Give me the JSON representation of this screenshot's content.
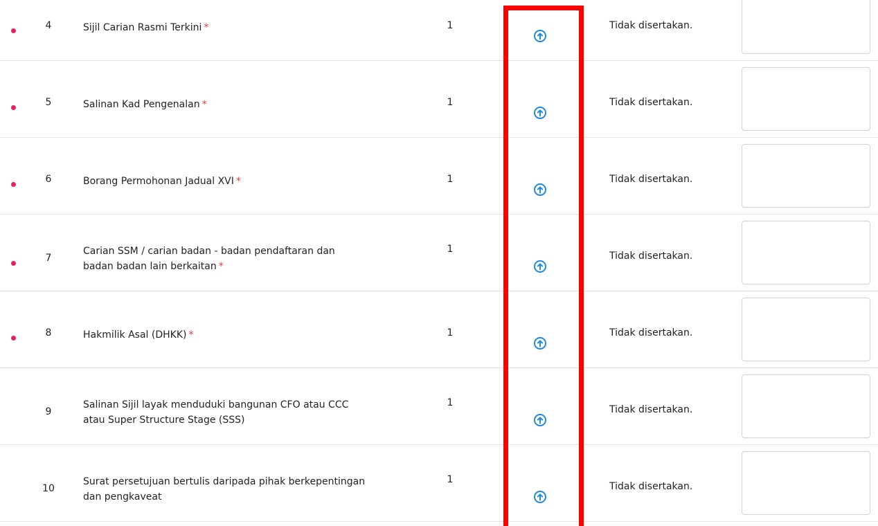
{
  "rows": [
    {
      "num": "4",
      "doc_lines": [
        "Sijil Carian Rasmi Terkini"
      ],
      "required": true,
      "qty": "1",
      "status": "Tidak disertakan."
    },
    {
      "num": "5",
      "doc_lines": [
        "Salinan Kad Pengenalan"
      ],
      "required": true,
      "qty": "1",
      "status": "Tidak disertakan."
    },
    {
      "num": "6",
      "doc_lines": [
        "Borang Permohonan Jadual XVI"
      ],
      "required": true,
      "qty": "1",
      "status": "Tidak disertakan."
    },
    {
      "num": "7",
      "doc_lines": [
        "Carian  SSM / carian badan - badan pendaftaran dan",
        "badan badan lain berkaitan"
      ],
      "required": true,
      "qty": "1",
      "status": "Tidak disertakan."
    },
    {
      "num": "8",
      "doc_lines": [
        "Hakmilik Asal (DHKK)"
      ],
      "required": true,
      "qty": "1",
      "status": "Tidak disertakan."
    },
    {
      "num": "9",
      "doc_lines": [
        "Salinan Sijil layak menduduki bangunan CFO atau CCC",
        "atau Super Structure Stage (SSS)"
      ],
      "required": false,
      "qty": "1",
      "status": "Tidak disertakan."
    },
    {
      "num": "10",
      "doc_lines": [
        "Surat persetujuan bertulis daripada pihak berkepentingan",
        "dan pengkaveat"
      ],
      "required": false,
      "qty": "1",
      "status": "Tidak disertakan."
    }
  ],
  "required_marker": "*",
  "upload_icon": "arrow-up-circle-icon",
  "colors": {
    "accent_blue": "#1e88e5",
    "required_red": "#e53935",
    "bullet_pink": "#e0245e",
    "highlight_red": "#ff0000"
  }
}
